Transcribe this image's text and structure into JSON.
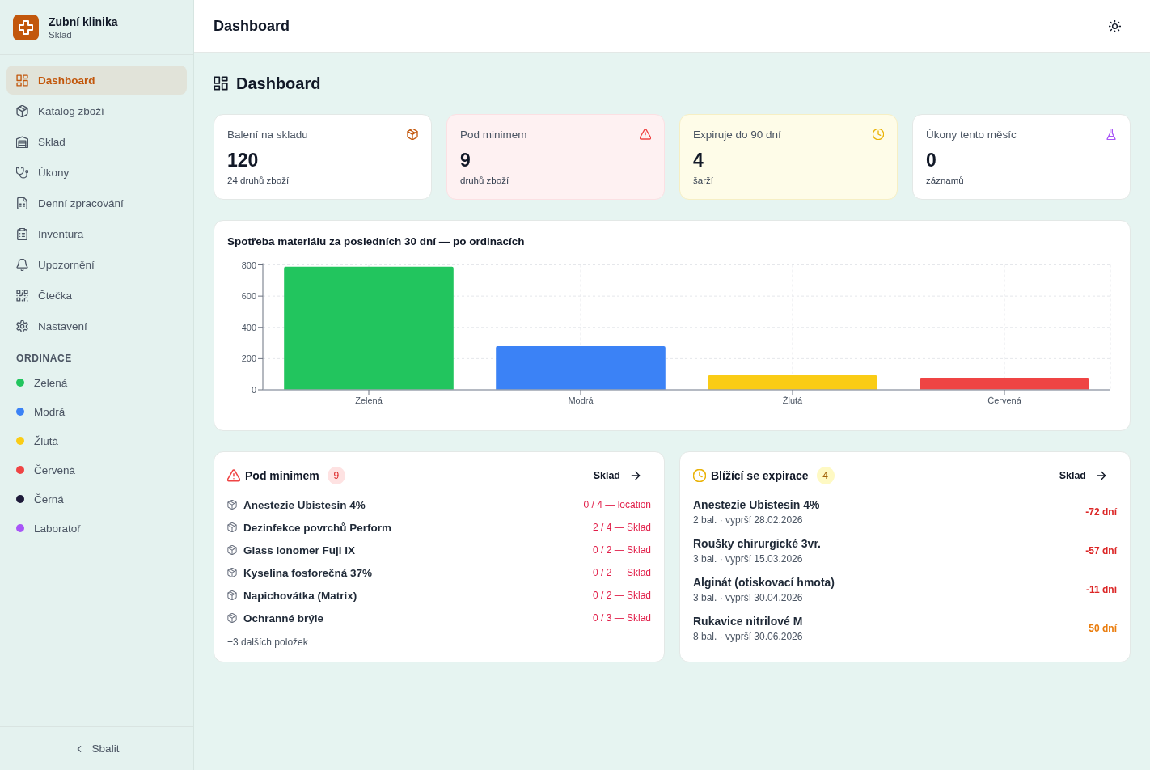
{
  "sidebar": {
    "brand": {
      "title": "Zubní klinika",
      "subtitle": "Sklad"
    },
    "nav": [
      {
        "label": "Dashboard",
        "selected": true
      },
      {
        "label": "Katalog zboží",
        "selected": false
      },
      {
        "label": "Sklad",
        "selected": false
      },
      {
        "label": "Úkony",
        "selected": false
      },
      {
        "label": "Denní zpracování",
        "selected": false
      },
      {
        "label": "Inventura",
        "selected": false
      },
      {
        "label": "Upozornění",
        "selected": false
      },
      {
        "label": "Čtečka",
        "selected": false
      },
      {
        "label": "Nastavení",
        "selected": false
      }
    ],
    "section_title": "ORDINACE",
    "practices": [
      {
        "label": "Zelená",
        "color": "#22c55e"
      },
      {
        "label": "Modrá",
        "color": "#3b82f6"
      },
      {
        "label": "Žlutá",
        "color": "#facc15"
      },
      {
        "label": "Červená",
        "color": "#ef4444"
      },
      {
        "label": "Černá",
        "color": "#1e1b3a"
      },
      {
        "label": "Laboratoř",
        "color": "#a855f7"
      }
    ],
    "collapse_button": "Sbalit"
  },
  "header": {
    "title": "Dashboard"
  },
  "page_title": "Dashboard",
  "stats": [
    {
      "kind": "stock",
      "label": "Balení na skladu",
      "value": "120",
      "note": "24 druhů zboží"
    },
    {
      "kind": "low",
      "label": "Pod minimem",
      "value": "9",
      "note": "druhů zboží"
    },
    {
      "kind": "expiry",
      "label": "Expiruje do 90 dní",
      "value": "4",
      "note": "šarží"
    },
    {
      "kind": "procedures",
      "label": "Úkony tento měsíc",
      "value": "0",
      "note": "záznamů"
    }
  ],
  "consumption": {
    "chart_data": {
      "type": "bar",
      "title": "Spotřeba materiálu za posledních 30 dní — po ordinacích",
      "categories": [
        "Zelená",
        "Modrá",
        "Žlutá",
        "Červená"
      ],
      "values": [
        788,
        280,
        93,
        78
      ],
      "ylim": [
        0,
        800
      ],
      "yticks": [
        0,
        200,
        400,
        600,
        800
      ],
      "grid": true
    }
  },
  "low_stock": {
    "title": "Pod minimem",
    "count": "9",
    "link": "Sklad",
    "items": [
      {
        "name": "Anestezie Ubistesin 4%",
        "stock": "0 / 4 — location"
      },
      {
        "name": "Dezinfekce povrchů Perform",
        "stock": "2 / 4 — Sklad"
      },
      {
        "name": "Glass ionomer Fuji IX",
        "stock": "0 / 2 — Sklad"
      },
      {
        "name": "Kyselina fosforečná 37%",
        "stock": "0 / 2 — Sklad"
      },
      {
        "name": "Napichovátka (Matrix)",
        "stock": "0 / 2 — Sklad"
      },
      {
        "name": "Ochranné brýle",
        "stock": "0 / 3 — Sklad"
      }
    ],
    "more": "+3 dalších položek"
  },
  "expiring": {
    "title": "Blížící se expirace",
    "count": "4",
    "link": "Sklad",
    "items": [
      {
        "name": "Anestezie Ubistesin 4%",
        "detail": "2 bal. · vyprší 28.02.2026",
        "days": "-72 dní",
        "expired": true
      },
      {
        "name": "Roušky chirurgické 3vr.",
        "detail": "3 bal. · vyprší 15.03.2026",
        "days": "-57 dní",
        "expired": true
      },
      {
        "name": "Alginát (otiskovací hmota)",
        "detail": "3 bal. · vyprší 30.04.2026",
        "days": "-11 dní",
        "expired": true
      },
      {
        "name": "Rukavice nitrilové M",
        "detail": "8 bal. · vyprší 30.06.2026",
        "days": "50 dní",
        "expired": false
      }
    ]
  }
}
